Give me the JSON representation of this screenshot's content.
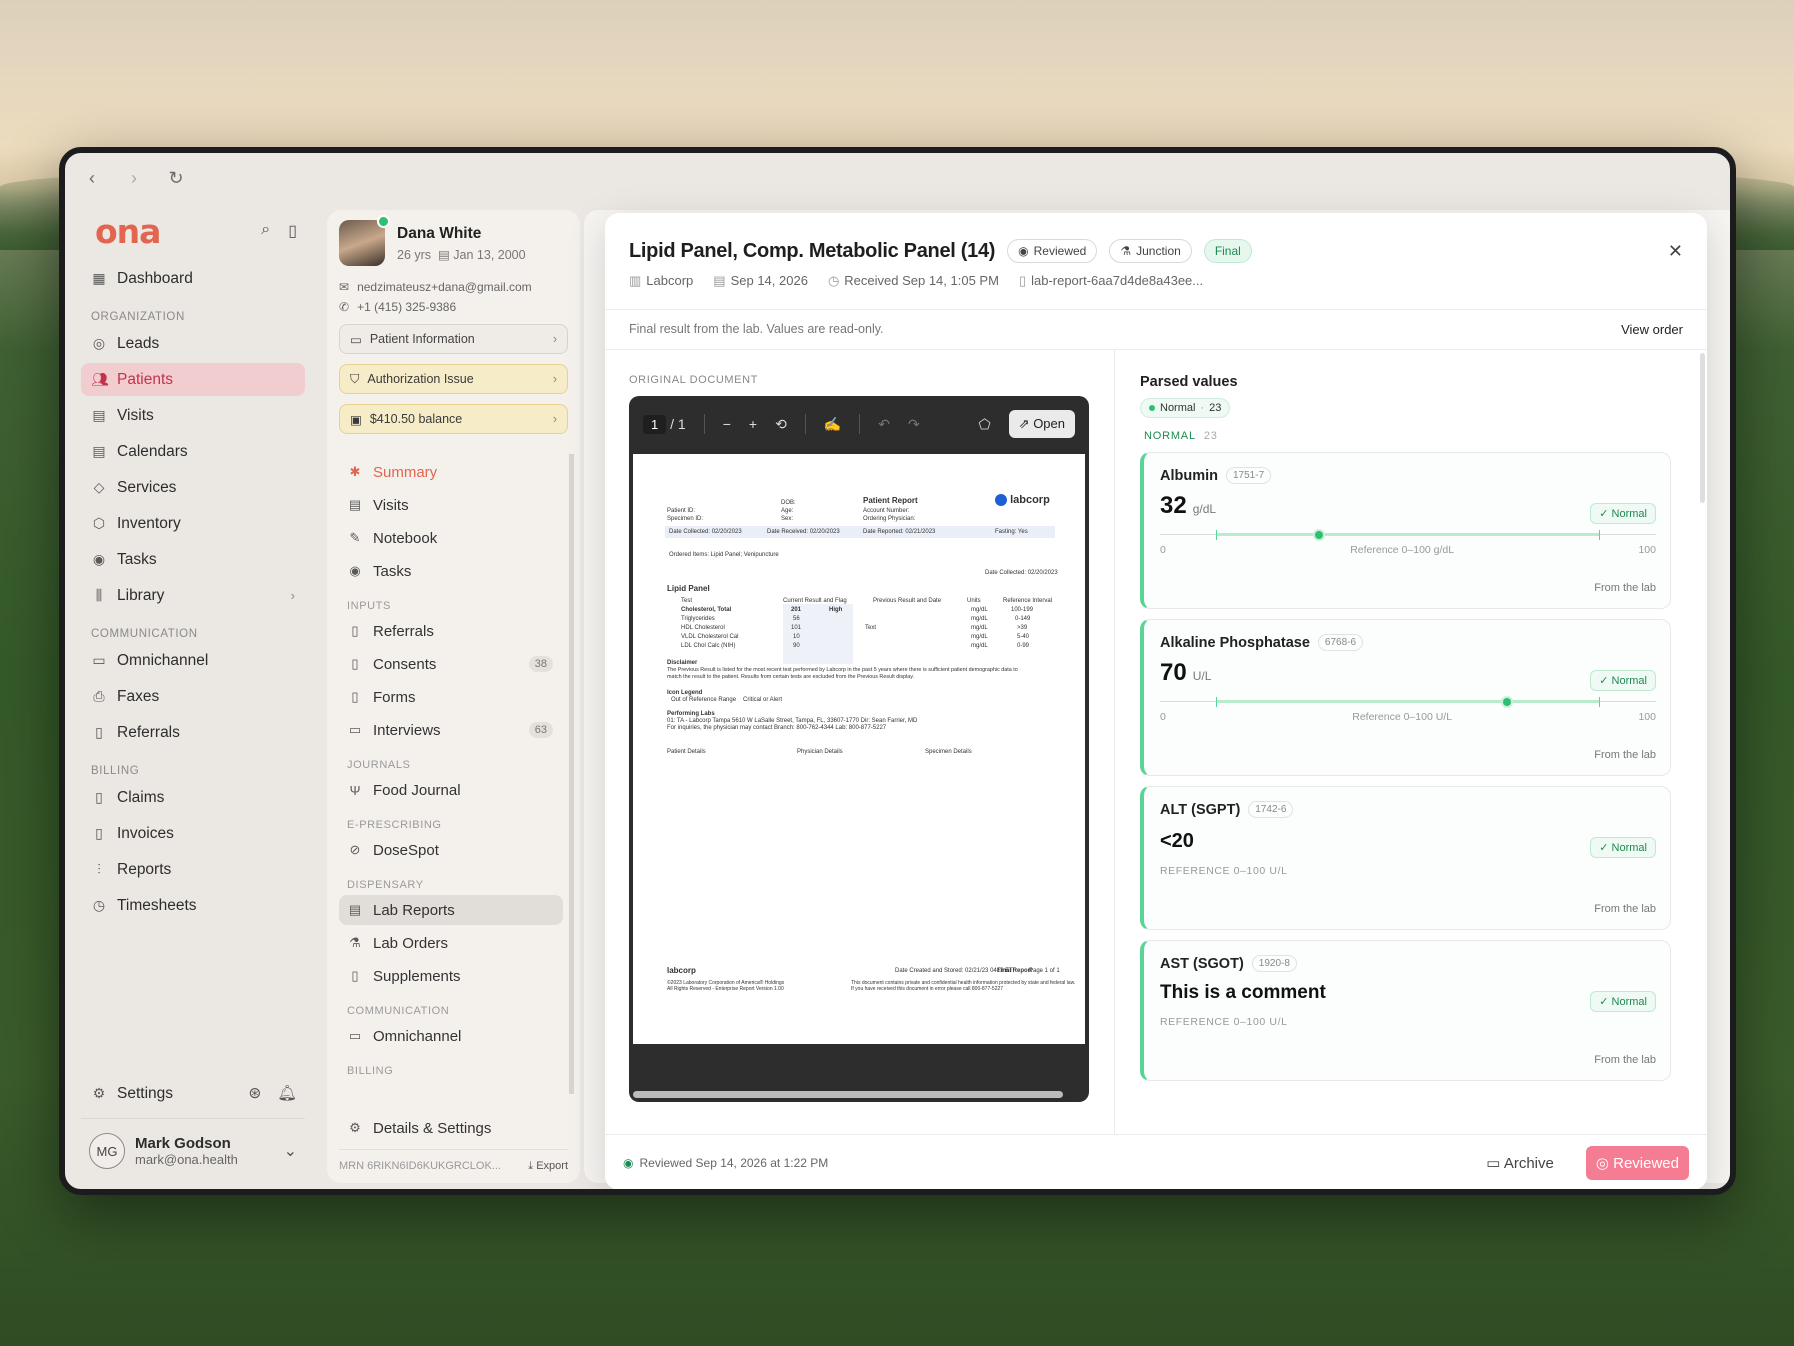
{
  "browser": {
    "back": "‹",
    "forward": "›",
    "reload": "↻"
  },
  "app": {
    "logo": "ona"
  },
  "sidebar": {
    "top": [
      {
        "label": "Dashboard",
        "icon": "dashboard-icon"
      }
    ],
    "org_label": "ORGANIZATION",
    "org": [
      {
        "label": "Leads",
        "icon": "target-icon"
      },
      {
        "label": "Patients",
        "icon": "users-icon"
      },
      {
        "label": "Visits",
        "icon": "calendar-icon"
      },
      {
        "label": "Calendars",
        "icon": "calendar-icon"
      },
      {
        "label": "Services",
        "icon": "tag-icon"
      },
      {
        "label": "Inventory",
        "icon": "box-icon"
      },
      {
        "label": "Tasks",
        "icon": "check-circle-icon"
      },
      {
        "label": "Library",
        "icon": "library-icon"
      }
    ],
    "comm_label": "COMMUNICATION",
    "comm": [
      {
        "label": "Omnichannel"
      },
      {
        "label": "Faxes"
      },
      {
        "label": "Referrals"
      }
    ],
    "billing_label": "BILLING",
    "billing": [
      {
        "label": "Claims"
      },
      {
        "label": "Invoices"
      },
      {
        "label": "Reports"
      },
      {
        "label": "Timesheets"
      }
    ],
    "settings": "Settings",
    "user": {
      "initials": "MG",
      "name": "Mark Godson",
      "email": "mark@ona.health"
    }
  },
  "patient": {
    "name": "Dana White",
    "age": "26 yrs",
    "dob": "Jan 13, 2000",
    "email": "nedzimateusz+dana@gmail.com",
    "phone": "+1 (415) 325-9386",
    "info_btn": "Patient Information",
    "auth_btn": "Authorization Issue",
    "balance_btn": "$410.50 balance",
    "nav": {
      "summary": "Summary",
      "visits": "Visits",
      "notebook": "Notebook",
      "tasks": "Tasks",
      "inputs_label": "INPUTS",
      "referrals": "Referrals",
      "consents": "Consents",
      "consents_count": "38",
      "forms": "Forms",
      "interviews": "Interviews",
      "interviews_count": "63",
      "journals_label": "JOURNALS",
      "food": "Food Journal",
      "erx_label": "E-PRESCRIBING",
      "dosespot": "DoseSpot",
      "disp_label": "DISPENSARY",
      "lab_reports": "Lab Reports",
      "lab_orders": "Lab Orders",
      "supplements": "Supplements",
      "comm_label": "COMMUNICATION",
      "omni": "Omnichannel",
      "billing_label": "BILLING"
    },
    "details": "Details & Settings",
    "mrn": "MRN 6RIKN6ID6KUKGRCLOK...",
    "export": "Export"
  },
  "modal": {
    "title": "Lipid Panel, Comp. Metabolic Panel (14)",
    "status": "Reviewed",
    "source": "Junction",
    "final": "Final",
    "lab": "Labcorp",
    "date": "Sep 14, 2026",
    "received": "Received Sep 14, 1:05 PM",
    "file": "lab-report-6aa7d4de8a43ee...",
    "note": "Final result from the lab. Values are read-only.",
    "view_order": "View order",
    "doc_label": "ORIGINAL DOCUMENT",
    "viewer": {
      "page": "1",
      "total": "/ 1",
      "open": "Open"
    },
    "parsed_title": "Parsed values",
    "chip_label": "Normal",
    "chip_count": "23",
    "normal_label": "NORMAL",
    "normal_count": "23",
    "values": [
      {
        "name": "Albumin",
        "code": "1751-7",
        "value": "32",
        "unit": "g/dL",
        "status": "Normal",
        "level": 32,
        "min": "0",
        "max": "100",
        "ref": "Reference 0–100 g/dL",
        "from": "From the lab"
      },
      {
        "name": "Alkaline Phosphatase",
        "code": "6768-6",
        "value": "70",
        "unit": "U/L",
        "status": "Normal",
        "level": 70,
        "min": "0",
        "max": "100",
        "ref": "Reference 0–100 U/L",
        "from": "From the lab"
      },
      {
        "name": "ALT (SGPT)",
        "code": "1742-6",
        "value": "<20",
        "status": "Normal",
        "ref": "REFERENCE  0–100 U/L",
        "from": "From the lab"
      },
      {
        "name": "AST (SGOT)",
        "code": "1920-8",
        "value": "This is a comment",
        "status": "Normal",
        "ref": "REFERENCE  0–100 U/L",
        "from": "From the lab"
      }
    ],
    "reviewed_note": "Reviewed Sep 14, 2026 at 1:22 PM",
    "archive": "Archive",
    "reviewed_btn": "Reviewed"
  },
  "report": {
    "title": "Patient Report",
    "brand": "labcorp",
    "patient_id": "Patient ID:",
    "specimen_id": "Specimen ID:",
    "dob": "DOB:",
    "age": "Age:",
    "sex": "Sex:",
    "acct": "Account Number:",
    "ordering": "Ordering Physician:",
    "collected": "Date Collected: 02/20/2023",
    "received": "Date Received: 02/20/2023",
    "reported": "Date Reported: 02/21/2023",
    "fasting": "Fasting: Yes",
    "ordered": "Ordered Items: Lipid Panel; Venipuncture",
    "dc": "Date Collected: 02/20/2023",
    "panel": "Lipid Panel",
    "h_test": "Test",
    "h_cur": "Current Result and Flag",
    "h_prev": "Previous Result and Date",
    "h_units": "Units",
    "h_ref": "Reference Interval",
    "rows": [
      {
        "test": "Cholesterol, Total",
        "val": "201",
        "flag": "High",
        "units": "mg/dL",
        "ref": "100-199"
      },
      {
        "test": "Triglycerides",
        "val": "56",
        "flag": "",
        "units": "mg/dL",
        "ref": "0-149"
      },
      {
        "test": "HDL Cholesterol",
        "val": "101",
        "flag": "",
        "units": "mg/dL",
        "ref": ">39"
      },
      {
        "test": "VLDL Cholesterol Cal",
        "val": "10",
        "flag": "",
        "units": "mg/dL",
        "ref": "5-40"
      },
      {
        "test": "LDL Chol Calc (NIH)",
        "val": "90",
        "flag": "",
        "units": "mg/dL",
        "ref": "0-99"
      }
    ],
    "text_note": "Text",
    "disclaimer_h": "Disclaimer",
    "disclaimer": "The Previous Result is listed for the most recent test performed by Labcorp in the past 5 years where there is sufficient patient demographic data to",
    "disclaimer2": "match the result to the patient. Results from certain tests are excluded from the Previous Result display.",
    "legend_h": "Icon Legend",
    "legend1": "Out of Reference Range",
    "legend2": "Critical or Alert",
    "perf_h": "Performing Labs",
    "perf1": "01: TA - Labcorp Tampa 5610 W LaSalle Street, Tampa, FL, 33607-1770 Dir: Sean Farrier, MD",
    "perf2": "For inquiries, the physician may contact Branch: 800-762-4344 Lab: 800-877-5227",
    "pd": "Patient Details",
    "phd": "Physician Details",
    "sd": "Specimen Details",
    "footer_stored": "Date Created and Stored: 02/21/23 0413 ET",
    "footer_final": "Final Report",
    "footer_page": "Page 1 of 1",
    "copyright": "©2023 Laboratory Corporation of America® Holdings",
    "rights": "All Rights Reserved - Enterprise Report Version 1.00",
    "confidential": "This document contains private and confidential health information protected by state and federal law.",
    "confidential2": "If you have received this document in error please call 800-877-5227"
  }
}
